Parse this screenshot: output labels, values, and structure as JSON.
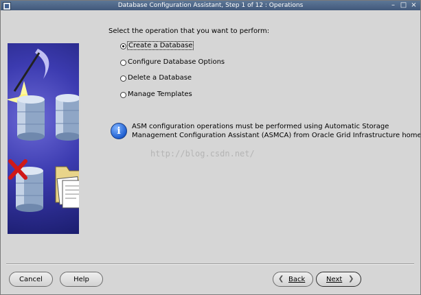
{
  "window": {
    "title": "Database Configuration Assistant, Step 1 of 12 : Operations",
    "controls": {
      "minimize": "–",
      "maximize": "□",
      "close": "×"
    }
  },
  "main": {
    "prompt": "Select the operation that you want to perform:",
    "options": [
      {
        "label": "Create a Database",
        "selected": true
      },
      {
        "label": "Configure Database Options",
        "selected": false
      },
      {
        "label": "Delete a Database",
        "selected": false
      },
      {
        "label": "Manage Templates",
        "selected": false
      }
    ],
    "info": {
      "icon": "info-icon",
      "line1": "ASM configuration operations must be performed using Automatic Storage",
      "line2": "Management Configuration Assistant (ASMCA) from Oracle Grid Infrastructure home."
    },
    "watermark": "http://blog.csdn.net/"
  },
  "footer": {
    "cancel": "Cancel",
    "help": "Help",
    "back": "Back",
    "next": "Next"
  },
  "colors": {
    "background": "#d6d6d6",
    "titlebar": "#4b6587",
    "art_background": "#3c3bb0",
    "info_icon": "#1f5fd0",
    "delete_mark": "#d01818",
    "check_mark": "#d01818"
  }
}
